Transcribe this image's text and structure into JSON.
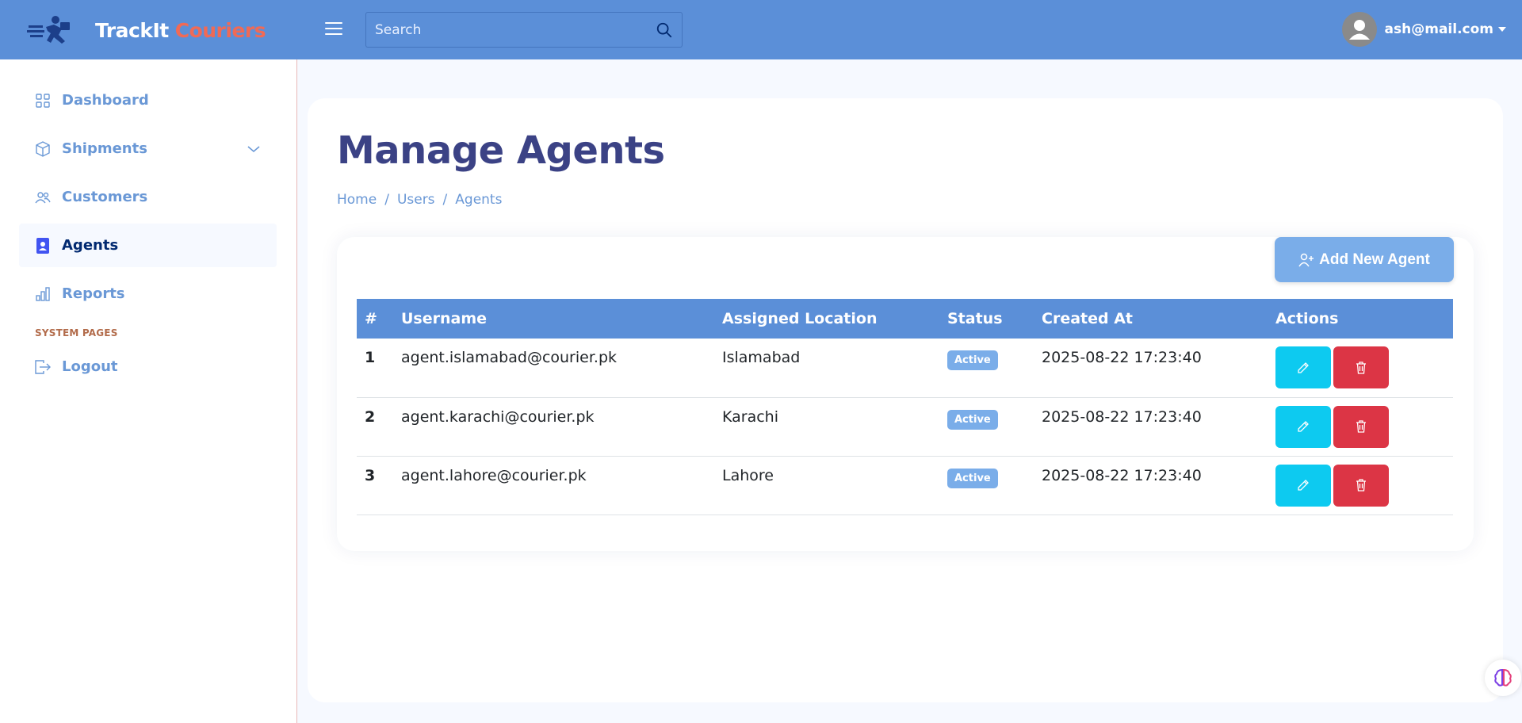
{
  "header": {
    "brand_part1": "TrackIt",
    "brand_part2": "Couriers",
    "search_placeholder": "Search",
    "user_email": "ash@mail.com",
    "accent_color": "#5b8fd8"
  },
  "sidebar": {
    "items": [
      {
        "label": "Dashboard",
        "icon": "grid-icon"
      },
      {
        "label": "Shipments",
        "icon": "box-icon"
      },
      {
        "label": "Customers",
        "icon": "people-icon"
      },
      {
        "label": "Agents",
        "icon": "person-badge-icon"
      },
      {
        "label": "Reports",
        "icon": "bar-chart-icon"
      }
    ],
    "section_heading": "SYSTEM PAGES",
    "logout_label": "Logout"
  },
  "main": {
    "page_title": "Manage Agents",
    "breadcrumb": [
      "Home",
      "Users",
      "Agents"
    ],
    "add_button_label": "Add New Agent",
    "table": {
      "headers": [
        "#",
        "Username",
        "Assigned Location",
        "Status",
        "Created At",
        "Actions"
      ],
      "rows": [
        {
          "num": "1",
          "username": "agent.islamabad@courier.pk",
          "location": "Islamabad",
          "status": "Active",
          "created": "2025-08-22 17:23:40"
        },
        {
          "num": "2",
          "username": "agent.karachi@courier.pk",
          "location": "Karachi",
          "status": "Active",
          "created": "2025-08-22 17:23:40"
        },
        {
          "num": "3",
          "username": "agent.lahore@courier.pk",
          "location": "Lahore",
          "status": "Active",
          "created": "2025-08-22 17:23:40"
        }
      ]
    }
  }
}
